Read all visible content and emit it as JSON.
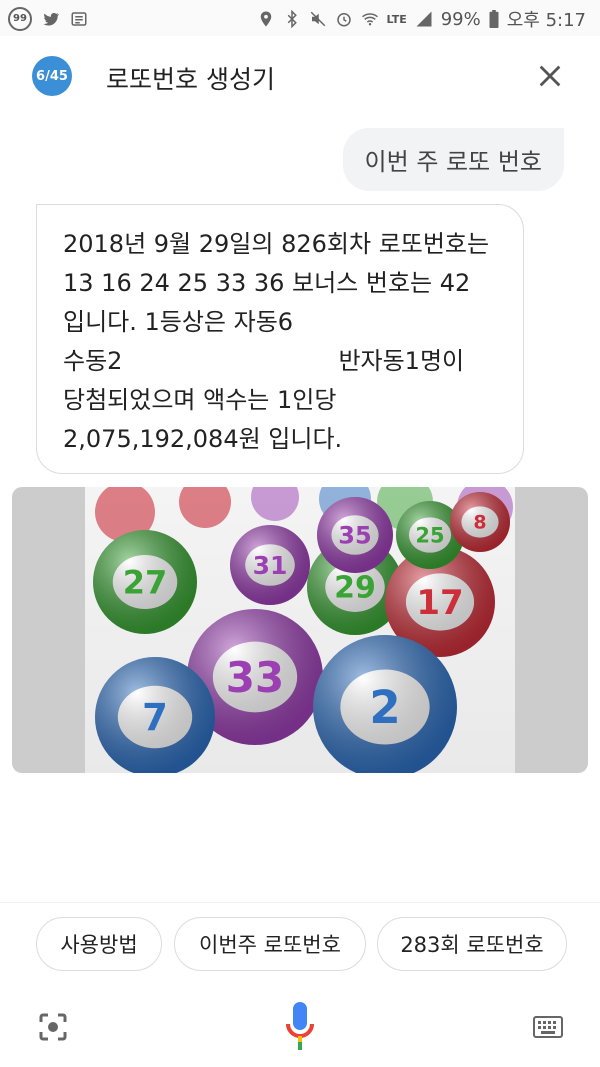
{
  "status_bar": {
    "badge": "99",
    "network": "LTE",
    "battery": "99%",
    "time": "오후 5:17"
  },
  "header": {
    "logo_main": "6/45",
    "title": "로또번호 생성기"
  },
  "chat": {
    "user_message": "이번 주 로또 번호",
    "bot_lines": [
      "2018년 9월 29일의 826회차 로또번호는",
      "13 16 24 25 33 36 보너스 번호는 42",
      "입니다. 1등상은 자동6",
      "수동2",
      "반자동1명이",
      "당첨되었으며 액수는 1인당",
      "2,075,192,084원 입니다."
    ]
  },
  "image": {
    "balls": [
      {
        "num": "31",
        "color": "#9b3fb3"
      },
      {
        "num": "29",
        "color": "#3aa335"
      },
      {
        "num": "27",
        "color": "#3aa335"
      },
      {
        "num": "33",
        "color": "#9b3fb3"
      },
      {
        "num": "17",
        "color": "#cc2f3a"
      },
      {
        "num": "35",
        "color": "#9b3fb3"
      },
      {
        "num": "25",
        "color": "#3aa335"
      },
      {
        "num": "8",
        "color": "#cc2f3a"
      },
      {
        "num": "2",
        "color": "#2e6fc0"
      },
      {
        "num": "7",
        "color": "#2e6fc0"
      }
    ]
  },
  "chips": [
    "사용방법",
    "이번주 로또번호",
    "283회 로또번호"
  ],
  "colors": {
    "mic_blue": "#4285f4",
    "mic_red": "#ea4335",
    "mic_yellow": "#fbbc05",
    "mic_green": "#34a853"
  }
}
